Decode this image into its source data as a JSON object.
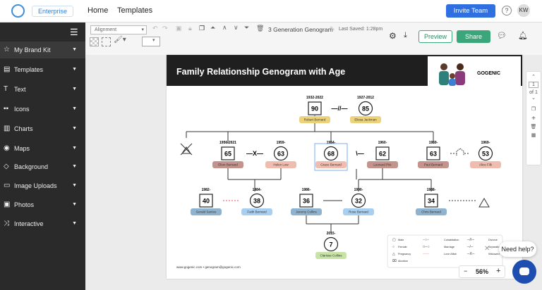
{
  "topbar": {
    "brand": "Enterprise",
    "nav": [
      "Home",
      "Templates"
    ],
    "invite": "Invite Team",
    "help": "?",
    "avatar": "KW"
  },
  "sidebar": {
    "items": [
      {
        "label": "My Brand Kit",
        "icon": "star-icon"
      },
      {
        "label": "Templates",
        "icon": "templates-icon"
      },
      {
        "label": "Text",
        "icon": "text-icon"
      },
      {
        "label": "Icons",
        "icon": "icons-icon"
      },
      {
        "label": "Charts",
        "icon": "chart-icon"
      },
      {
        "label": "Maps",
        "icon": "map-icon"
      },
      {
        "label": "Background",
        "icon": "background-icon"
      },
      {
        "label": "Image Uploads",
        "icon": "upload-icon"
      },
      {
        "label": "Photos",
        "icon": "photo-icon"
      },
      {
        "label": "Interactive",
        "icon": "interactive-icon"
      }
    ]
  },
  "toolbar": {
    "alignment": "Alignment",
    "doc_title": "3 Generation Genogram",
    "last_saved": "Last Saved: 1:28pm",
    "preview": "Preview",
    "share": "Share"
  },
  "genogram": {
    "title": "Family Relationship Genogram with Age",
    "brand": "GOGENIC",
    "footer": "www.gogenic.com • genogram@gogenic.com",
    "people": [
      {
        "name": "Robert Bernard",
        "years": "1932-2022",
        "age": "90",
        "shape": "square",
        "color": "#ecd27a"
      },
      {
        "name": "Elissa Jackman",
        "years": "1927-2012",
        "age": "85",
        "shape": "circle",
        "color": "#ecd27a"
      },
      {
        "name": "Elton Bernard",
        "years": "1956-2021",
        "age": "65",
        "shape": "square",
        "color": "#c4938c"
      },
      {
        "name": "Helen Low",
        "years": "1959-",
        "age": "63",
        "shape": "circle",
        "color": "#f1bcb0"
      },
      {
        "name": "Grace Bernard",
        "years": "1954-",
        "age": "68",
        "shape": "circle",
        "color": "#f1bcb0"
      },
      {
        "name": "Leonard Pitz",
        "years": "1960-",
        "age": "62",
        "shape": "square",
        "color": "#c4938c"
      },
      {
        "name": "Paul Bernard",
        "years": "1959-",
        "age": "63",
        "shape": "square",
        "color": "#c4938c"
      },
      {
        "name": "Alice Filk",
        "years": "1969-",
        "age": "53",
        "shape": "circle",
        "color": "#f1bcb0"
      },
      {
        "name": "Gerald Santos",
        "years": "1982-",
        "age": "40",
        "shape": "square",
        "color": "#8fb3cf"
      },
      {
        "name": "Faith Bernard",
        "years": "1984-",
        "age": "38",
        "shape": "circle",
        "color": "#a8cff0"
      },
      {
        "name": "Jeremy Collins",
        "years": "1986-",
        "age": "36",
        "shape": "square",
        "color": "#8fb3cf"
      },
      {
        "name": "Rose Bernard",
        "years": "1990-",
        "age": "32",
        "shape": "circle",
        "color": "#a8cff0"
      },
      {
        "name": "Chris Bernard",
        "years": "1988-",
        "age": "34",
        "shape": "square",
        "color": "#8fb3cf"
      },
      {
        "name": "Clarisse Collins",
        "years": "2015-",
        "age": "7",
        "shape": "circle",
        "color": "#c7e3a6"
      }
    ],
    "relations": {
      "divorce": "—//—",
      "separation": "—X—",
      "widowed": "\\—"
    },
    "legend": [
      {
        "label": "Male"
      },
      {
        "label": "Female"
      },
      {
        "label": "Pregnancy"
      },
      {
        "label": "Abortion"
      },
      {
        "label": "Cohabitation"
      },
      {
        "label": "Marriage"
      },
      {
        "label": "Love Affair"
      },
      {
        "label": "Divorce"
      },
      {
        "label": "Separation"
      },
      {
        "label": "Widowed"
      }
    ]
  },
  "zoom": {
    "page": "1",
    "of": "of 1",
    "level": "56%"
  },
  "help": {
    "label": "Need help?"
  }
}
